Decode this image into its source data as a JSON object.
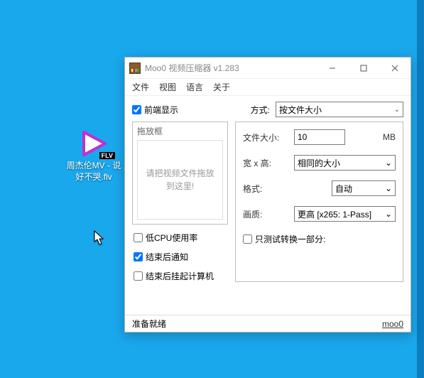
{
  "desktop": {
    "file_label": "周杰伦MV - 说好不哭.flv",
    "badge": "FLV"
  },
  "window": {
    "title": "Moo0 视频压缩器 v1.283",
    "menubar": [
      "文件",
      "视图",
      "语言",
      "关于"
    ],
    "front_checkbox": "前端显示",
    "method_label": "方式:",
    "method_value": "按文件大小",
    "dropzone_title": "拖放框",
    "dropzone_hint": "请把视频文件拖放到这里!",
    "left_checks": {
      "low_cpu": "低CPU使用率",
      "notify": "结束后通知",
      "shutdown": "结束后挂起计算机"
    },
    "fields": {
      "filesize_label": "文件大小:",
      "filesize_value": "10",
      "filesize_unit": "MB",
      "dimension_label": "宽 x 高:",
      "dimension_value": "相同的大小",
      "format_label": "格式:",
      "format_value": "自动",
      "quality_label": "画质:",
      "quality_value": "更高     [x265: 1-Pass]",
      "test_label": "只测试转换一部分:"
    },
    "statusbar": {
      "status": "准备就绪",
      "link": "moo0"
    }
  }
}
